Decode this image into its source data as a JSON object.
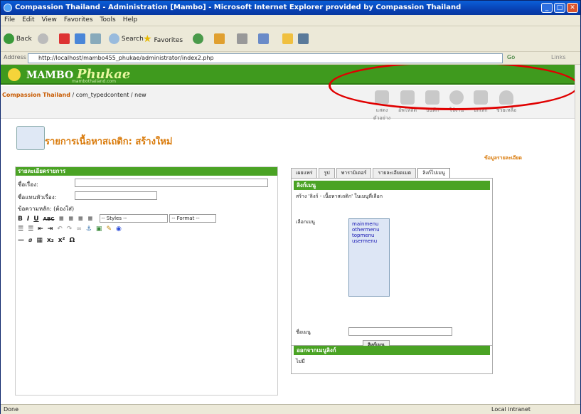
{
  "window": {
    "title": "Compassion Thailand - Administration [Mambo] - Microsoft Internet Explorer provided by Compassion Thailand"
  },
  "menubar": {
    "items": [
      "File",
      "Edit",
      "View",
      "Favorites",
      "Tools",
      "Help"
    ]
  },
  "toolbar": {
    "back": "Back",
    "search": "Search",
    "favorites": "Favorites"
  },
  "address": {
    "label": "Address",
    "url": "http://localhost/mambo455_phukae/administrator/index2.php",
    "go": "Go",
    "links": "Links"
  },
  "site": {
    "logo_main": "MAMBO",
    "logo_italic": "Phukae",
    "logo_sub": "mambothailand.com"
  },
  "breadcrumb": {
    "site": "Compassion Thailand",
    "path": " / com_typedcontent / new"
  },
  "admin_buttons": [
    "แสดงตัวอย่าง",
    "อัพโหลด",
    "บันทึก",
    "ใช้งาน",
    "ยกเลิก",
    "ช่วยเหลือ"
  ],
  "page": {
    "title": "รายการเนื้อหาสเถติก: สร้างใหม่",
    "right_link": "ข้อมูลรายละเอียด"
  },
  "left_panel": {
    "header": "รายละเอียดรายการ",
    "title_label": "ชื่อเรื่อง:",
    "alias_label": "ชื่อแทนหัวเรื่อง:",
    "text_label": "ข้อความหลัก: (ต้องใส่)",
    "styles_placeholder": "-- Styles --",
    "format_placeholder": "-- Format --"
  },
  "right_panel": {
    "tabs": [
      "เผยแพร่",
      "รูป",
      "พารามิเตอร์",
      "รายละเอียดเมต",
      "ลิงก์ไปเมนู"
    ],
    "link_header": "ลิงก์เมนู",
    "link_desc": "สร้าง 'ลิงก์ - เนื้อหาสเถติก' ในเมนูที่เลือก",
    "menu_label": "เลือกเมนู",
    "menu_options": [
      "mainmenu",
      "othermenu",
      "topmenu",
      "usermenu"
    ],
    "name_label": "ชื่อเมนู",
    "link_button": "ลิงก์เมนู",
    "existing_header": "ออกจากเมนูลิงก์",
    "existing_value": "ไม่มี"
  },
  "status": {
    "left": "Done",
    "right": "Local intranet"
  },
  "colors": {
    "accent": "#3f9a1e",
    "title": "#d97a0a",
    "highlight": "#e00000"
  }
}
